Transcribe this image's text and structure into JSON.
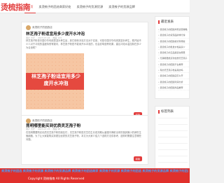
{
  "header": {
    "logo": "烫梳指南",
    "nav": [
      "首页",
      "卖烫梳子的团选商家好处",
      "卖烫梳子的货源货源",
      "卖烫梳子的货源品牌"
    ]
  },
  "posts": [
    {
      "author": "卖烫梳子的团选店",
      "title": "林芝孢子粉适宜用多少度开水冲泡",
      "meta": [
        "用户 大厅",
        "2023-07-16",
        "热度 123"
      ],
      "excerpt": "林芝孢子粉是中国中华传统类滋补养生品，其它粉粉冲泡方法对于实用，可是中国中华传统类滋补养生，刚开始不少人对于冲泡的温度特别有疑问，林芝孢子粉是不能用开水冲泡的，也会影响营养效果，建议冲泡水温控制在多少为合适呢？",
      "thumb_text": "林芝孢子粉适宜用多少度开水冲泡",
      "read_more": "阅读"
    },
    {
      "author": "卖烫梳子的团选店",
      "title": "昆明哪里能买到优质灵芝孢子粉",
      "meta": [
        "用户 大厅",
        "2023-07-15",
        "热度 98"
      ],
      "excerpt": "在昆明需要购买优质灵芝孢子粉的朋友们，灵芝孢子粉是灵芝在生长成熟期从菌褶中弹射出来的极其微小的卵形生殖细胞，为了让大家能购买到更加优质的灵芝孢子粉，本文为大家介绍几个选购方法供参考，选购时需要注意哪些问题。",
      "read_more": "阅读"
    }
  ],
  "sidebar": {
    "recent_title": "最近发表",
    "recent": [
      "卖烫梳子的团选商家运营策略",
      "卖烫梳子的货源品牌排行榜",
      "卖烫梳子的团选模式有哪些",
      "卖烫梳子的批发价格是多少",
      "卖烫梳子的正品渠道在哪里",
      "无锡哪里能买到优质灵芝孢子",
      "卖烫梳子的团选平台推荐",
      "有的灵芝孢子粉是真的吗",
      "卖烫梳子的团选店怎么开",
      "卖烫梳子的团选利润分析",
      "卖烫梳子的团选商品推荐"
    ],
    "tags_title": "标签列表"
  },
  "overlay": {
    "line1": "卖烫梳子的团选 卖烫梳子的货源 卖烫梳子的货源品牌 卖烫梳子的团选商家 卖烫梳子的货源 卖烫梳子的团选 卖烫梳子的货源品牌 卖烫梳子的团选 卖烫梳子",
    "line2": "Copyright 烫梳指南 All Rights Reserved"
  }
}
